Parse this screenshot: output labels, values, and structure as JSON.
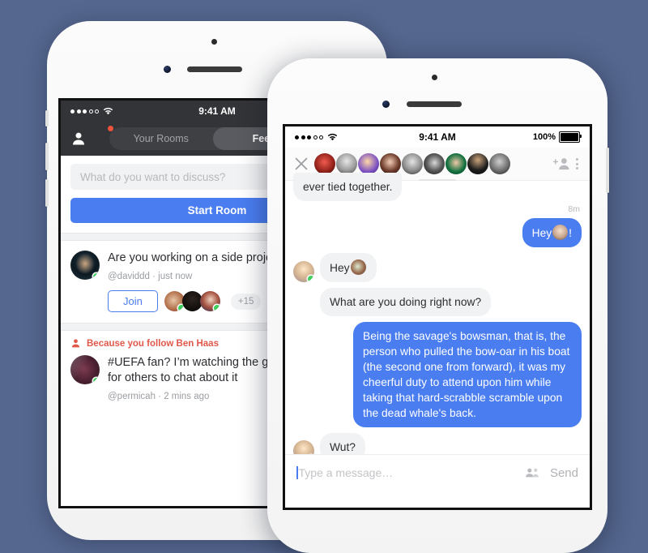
{
  "background_color": "#55678f",
  "accent_color": "#4a7df0",
  "phones": {
    "back": {
      "status_bar": {
        "time": "9:41 AM",
        "signal": "•••oo",
        "wifi": "wifi-icon"
      },
      "navbar": {
        "profile_icon": "person-icon",
        "tabs": [
          {
            "label": "Your Rooms",
            "active": false,
            "badge": true
          },
          {
            "label": "Feed",
            "active": true,
            "badge": false
          }
        ]
      },
      "compose": {
        "placeholder": "What do you want to discuss?",
        "start_room_label": "Start Room"
      },
      "posts": [
        {
          "text": "Are you working on a side project too. Let’s chat!",
          "meta": "@daviddd · just now",
          "join_label": "Join",
          "extra_count": "+15"
        },
        {
          "reason": "Because you follow Ben Haas",
          "reason_icon": "person-add-icon",
          "text": "#UEFA fan? I’m watching the game and looking for others to chat about it",
          "meta": "@permicah · 2 mins ago"
        }
      ]
    },
    "front": {
      "status_bar": {
        "time": "9:41 AM",
        "battery_label": "100%",
        "signal": "•••oo",
        "wifi": "wifi-icon"
      },
      "chat_header": {
        "close_icon": "close-icon",
        "add_person_icon": "add-person-icon",
        "menu_icon": "kebab-menu-icon",
        "participant_count": 9
      },
      "messages": [
        {
          "side": "in",
          "text": "ever tied together.",
          "partial": true,
          "avatar": false
        },
        {
          "side": "in",
          "timestamp": "8m"
        },
        {
          "side": "out",
          "text": "Hey",
          "suffix": "!",
          "inline_avatar": true
        },
        {
          "side": "in",
          "text": "Hey",
          "inline_avatar": true,
          "avatar": true
        },
        {
          "side": "in",
          "text": "What are you doing right now?"
        },
        {
          "side": "out",
          "text": "Being the savage's bowsman, that is, the person who pulled the bow-oar in his boat (the second one from forward), it was my cheerful duty to attend upon him while taking that hard-scrabble scramble upon the dead whale's back."
        },
        {
          "side": "in",
          "text": "Wut?",
          "avatar": true
        }
      ],
      "composer": {
        "placeholder": "Type a message…",
        "people_icon": "people-icon",
        "send_label": "Send"
      }
    }
  }
}
